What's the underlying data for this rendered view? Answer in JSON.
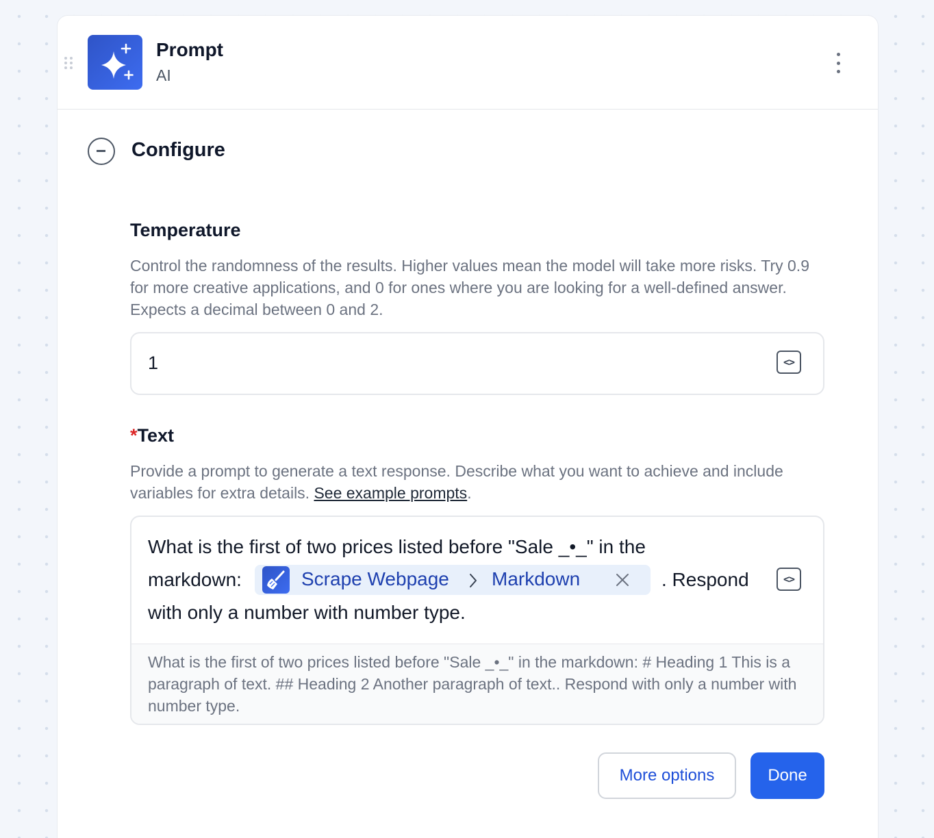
{
  "header": {
    "title": "Prompt",
    "subtitle": "AI",
    "icon": "sparkles-icon"
  },
  "section": {
    "title": "Configure",
    "toggle_icon": "collapse-circle-icon"
  },
  "temperature": {
    "label": "Temperature",
    "description": "Control the randomness of the results. Higher values mean the model will take more risks. Try 0.9 for more creative applications, and 0 for ones where you are looking for a well-defined answer. Expects a decimal between 0 and 2.",
    "value": "1"
  },
  "text": {
    "required_mark": "*",
    "label": "Text",
    "description_prefix": "Provide a prompt to generate a text response. Describe what you want to achieve and include variables for extra details. ",
    "description_link": "See example prompts",
    "description_suffix": ".",
    "prompt_line1": "What is the first of two prices listed before \"Sale _•_\" in the",
    "prompt_line2_prefix": "markdown:",
    "chip": {
      "source": "Scrape Webpage",
      "field": "Markdown",
      "icon": "broom-icon"
    },
    "prompt_line2_suffix": ". Respond",
    "prompt_line3": "with only a number with number type.",
    "preview": "What is the first of two prices listed before \"Sale _•_\" in the markdown: # Heading 1 This is a paragraph of text. ## Heading 2 Another paragraph of text.. Respond with only a number with number type."
  },
  "actions": {
    "more_options": "More options",
    "done": "Done"
  },
  "colors": {
    "accent": "#2563eb",
    "chip_bg": "#e8f0fb",
    "chip_text": "#1e40af",
    "required": "#dc2626"
  }
}
